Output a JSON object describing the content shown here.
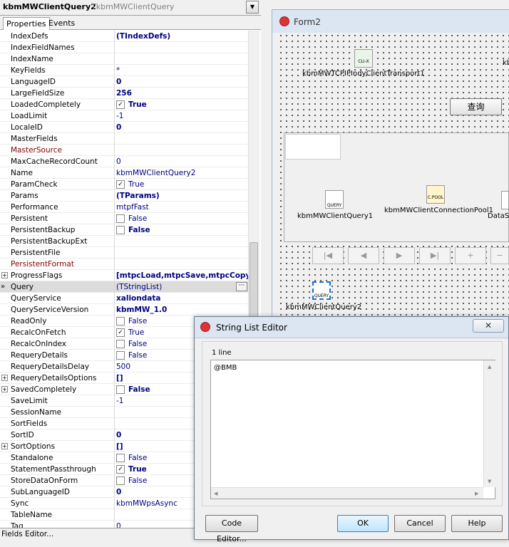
{
  "inspector": {
    "component_name": "kbmMWClientQuery2",
    "component_type": "TkbmMWClientQuery",
    "tabs": [
      "Properties",
      "Events"
    ],
    "status": "Fields Editor...",
    "rows": [
      {
        "name": "IndexDefs",
        "value": "(TIndexDefs)",
        "bold": true
      },
      {
        "name": "IndexFieldNames",
        "value": ""
      },
      {
        "name": "IndexName",
        "value": ""
      },
      {
        "name": "KeyFields",
        "value": "*"
      },
      {
        "name": "LanguageID",
        "value": "0",
        "bold": true
      },
      {
        "name": "LargeFieldSize",
        "value": "256",
        "bold": true
      },
      {
        "name": "LoadedCompletely",
        "value": "True",
        "bold": true,
        "check": true
      },
      {
        "name": "LoadLimit",
        "value": "-1"
      },
      {
        "name": "LocaleID",
        "value": "0",
        "bold": true
      },
      {
        "name": "MasterFields",
        "value": ""
      },
      {
        "name": "MasterSource",
        "value": "",
        "red": true
      },
      {
        "name": "MaxCacheRecordCount",
        "value": "0"
      },
      {
        "name": "Name",
        "value": "kbmMWClientQuery2"
      },
      {
        "name": "ParamCheck",
        "value": "True",
        "check": true
      },
      {
        "name": "Params",
        "value": "(TParams)",
        "bold": true
      },
      {
        "name": "Performance",
        "value": "mtpfFast"
      },
      {
        "name": "Persistent",
        "value": "False",
        "check": false
      },
      {
        "name": "PersistentBackup",
        "value": "False",
        "bold": true,
        "check": false
      },
      {
        "name": "PersistentBackupExt",
        "value": ""
      },
      {
        "name": "PersistentFile",
        "value": ""
      },
      {
        "name": "PersistentFormat",
        "value": "",
        "red": true
      },
      {
        "name": "ProgressFlags",
        "value": "[mtpcLoad,mtpcSave,mtpcCopy]",
        "bold": true,
        "expand": true
      },
      {
        "name": "Query",
        "value": "(TStringList)",
        "selected": true
      },
      {
        "name": "QueryService",
        "value": "xaliondata",
        "bold": true
      },
      {
        "name": "QueryServiceVersion",
        "value": "kbmMW_1.0",
        "bold": true
      },
      {
        "name": "ReadOnly",
        "value": "False",
        "check": false
      },
      {
        "name": "RecalcOnFetch",
        "value": "True",
        "check": true
      },
      {
        "name": "RecalcOnIndex",
        "value": "False",
        "check": false
      },
      {
        "name": "RequeryDetails",
        "value": "False",
        "check": false
      },
      {
        "name": "RequeryDetailsDelay",
        "value": "500"
      },
      {
        "name": "RequeryDetailsOptions",
        "value": "[]",
        "bold": true,
        "expand": true
      },
      {
        "name": "SavedCompletely",
        "value": "False",
        "bold": true,
        "check": false,
        "expand": true
      },
      {
        "name": "SaveLimit",
        "value": "-1"
      },
      {
        "name": "SessionName",
        "value": ""
      },
      {
        "name": "SortFields",
        "value": ""
      },
      {
        "name": "SortID",
        "value": "0",
        "bold": true
      },
      {
        "name": "SortOptions",
        "value": "[]",
        "bold": true,
        "expand": true
      },
      {
        "name": "Standalone",
        "value": "False",
        "check": false
      },
      {
        "name": "StatementPassthrough",
        "value": "True",
        "bold": true,
        "check": true
      },
      {
        "name": "StoreDataOnForm",
        "value": "False",
        "check": false
      },
      {
        "name": "SubLanguageID",
        "value": "0",
        "bold": true
      },
      {
        "name": "Sync",
        "value": "kbmMWpsAsync"
      },
      {
        "name": "TableName",
        "value": ""
      },
      {
        "name": "Tag",
        "value": "0"
      }
    ]
  },
  "form": {
    "title": "Form2",
    "query_button": "查询",
    "components": {
      "transport": {
        "label": "kbmMWTCPIPIndyClientTransport1",
        "glyph": "CLI-X"
      },
      "query1": {
        "label": "kbmMWClientQuery1",
        "glyph": "QUERY"
      },
      "pool": {
        "label": "kbmMWClientConnectionPool1",
        "glyph": "C.POOL"
      },
      "datasource": {
        "label": "DataS"
      },
      "query2": {
        "label": "kbmMWClientQuery2",
        "glyph": "QUERY"
      },
      "cut_label": "kb"
    },
    "navigator": [
      "|◀",
      "◀",
      "▶",
      "▶|",
      "+",
      "−"
    ]
  },
  "dialog": {
    "title": "String List Editor",
    "line_count": "1 line",
    "text": "@BMB",
    "buttons": {
      "code_editor": "Code Editor...",
      "ok": "OK",
      "cancel": "Cancel",
      "help": "Help"
    },
    "close": "✕"
  }
}
